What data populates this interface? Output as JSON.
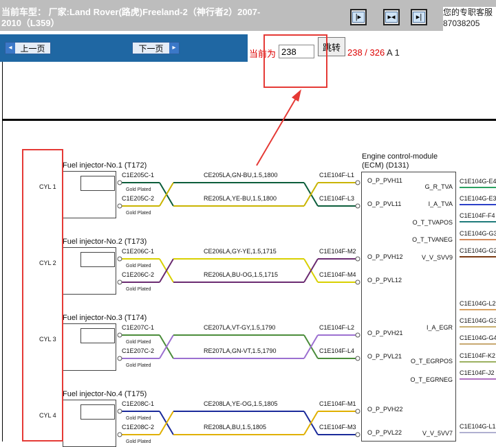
{
  "header": {
    "vehicle": "当前车型： 厂家:Land Rover(路虎)Freeland-2（神行者2）2007-2010（L359）",
    "service_text": "您的专职客服 87038205"
  },
  "pager": {
    "prev_label": "上一页",
    "next_label": "下一页",
    "current_label": "当前为",
    "page_value": "238",
    "jump_label": "跳转",
    "page_count": "238 / 326",
    "sheet_id": "A 1"
  },
  "diagram": {
    "ecm_title": "Engine control-module (ECM) (D131)",
    "cylinders": [
      {
        "cyl": "CYL 1",
        "injector": "Fuel injector-No.1 (T172)",
        "pin1": "C1E205C-1",
        "pin2": "C1E205C-2",
        "wire1": "CE205LA,GN-BU,1.5,1800",
        "wire2": "RE205LA,YE-BU,1.5,1800",
        "ecm_pin1": "C1E104F-L1",
        "ecm_pin2": "C1E104F-L3",
        "sig1": "O_P_PVH11",
        "sig2": "O_P_PVL11",
        "gold1": "Gold Plated",
        "gold2": "Gold Plated",
        "color_top": "#0b5d3a",
        "color_bot": "#c9b400"
      },
      {
        "cyl": "CYL 2",
        "injector": "Fuel injector-No.2 (T173)",
        "pin1": "C1E206C-1",
        "pin2": "C1E206C-2",
        "wire1": "CE206LA,GY-YE,1.5,1715",
        "wire2": "RE206LA,BU-OG,1.5,1715",
        "ecm_pin1": "C1E104F-M2",
        "ecm_pin2": "C1E104F-M4",
        "sig1": "O_P_PVH12",
        "sig2": "O_P_PVL12",
        "gold1": "Gold Plated",
        "gold2": "Gold Plated",
        "color_top": "#d8d000",
        "color_bot": "#6a2a70"
      },
      {
        "cyl": "CYL 3",
        "injector": "Fuel injector-No.3 (T174)",
        "pin1": "C1E207C-1",
        "pin2": "C1E207C-2",
        "wire1": "CE207LA,VT-GY,1.5,1790",
        "wire2": "RE207LA,GN-VT,1.5,1790",
        "ecm_pin1": "C1E104F-L2",
        "ecm_pin2": "C1E104F-L4",
        "sig1": "O_P_PVH21",
        "sig2": "O_P_PVL21",
        "gold1": "Gold Plated",
        "gold2": "Gold Plated",
        "color_top": "#4a8c3a",
        "color_bot": "#9b6fd0"
      },
      {
        "cyl": "CYL 4",
        "injector": "Fuel injector-No.4 (T175)",
        "pin1": "C1E208C-1",
        "pin2": "C1E208C-2",
        "wire1": "CE208LA,YE-OG,1.5,1805",
        "wire2": "RE208LA,BU,1.5,1805",
        "ecm_pin1": "C1E104F-M1",
        "ecm_pin2": "C1E104F-M3",
        "sig1": "O_P_PVH22",
        "sig2": "O_P_PVL22",
        "gold1": "Gold Plated",
        "gold2": "Gold Plated",
        "color_top": "#1a2a9a",
        "color_bot": "#e0b000"
      }
    ],
    "ecm_right_signals": [
      "G_R_TVA",
      "I_A_TVA",
      "O_T_TVAPOS",
      "O_T_TVANEG",
      "V_V_SVV9",
      "I_A_EGR",
      "O_T_EGRPOS",
      "O_T_EGRNEG",
      "V_V_5VV7"
    ],
    "ecm_right_pins": [
      "C1E104G-E4",
      "C1E104G-E3",
      "C1E104F-F4",
      "C1E104G-G3",
      "C1E104G-G2",
      "C1E104G-L2",
      "C1E104G-G3",
      "C1E104G-G4",
      "C1E104F-K2",
      "C1E104F-J2",
      "C1E104G-L1"
    ]
  }
}
